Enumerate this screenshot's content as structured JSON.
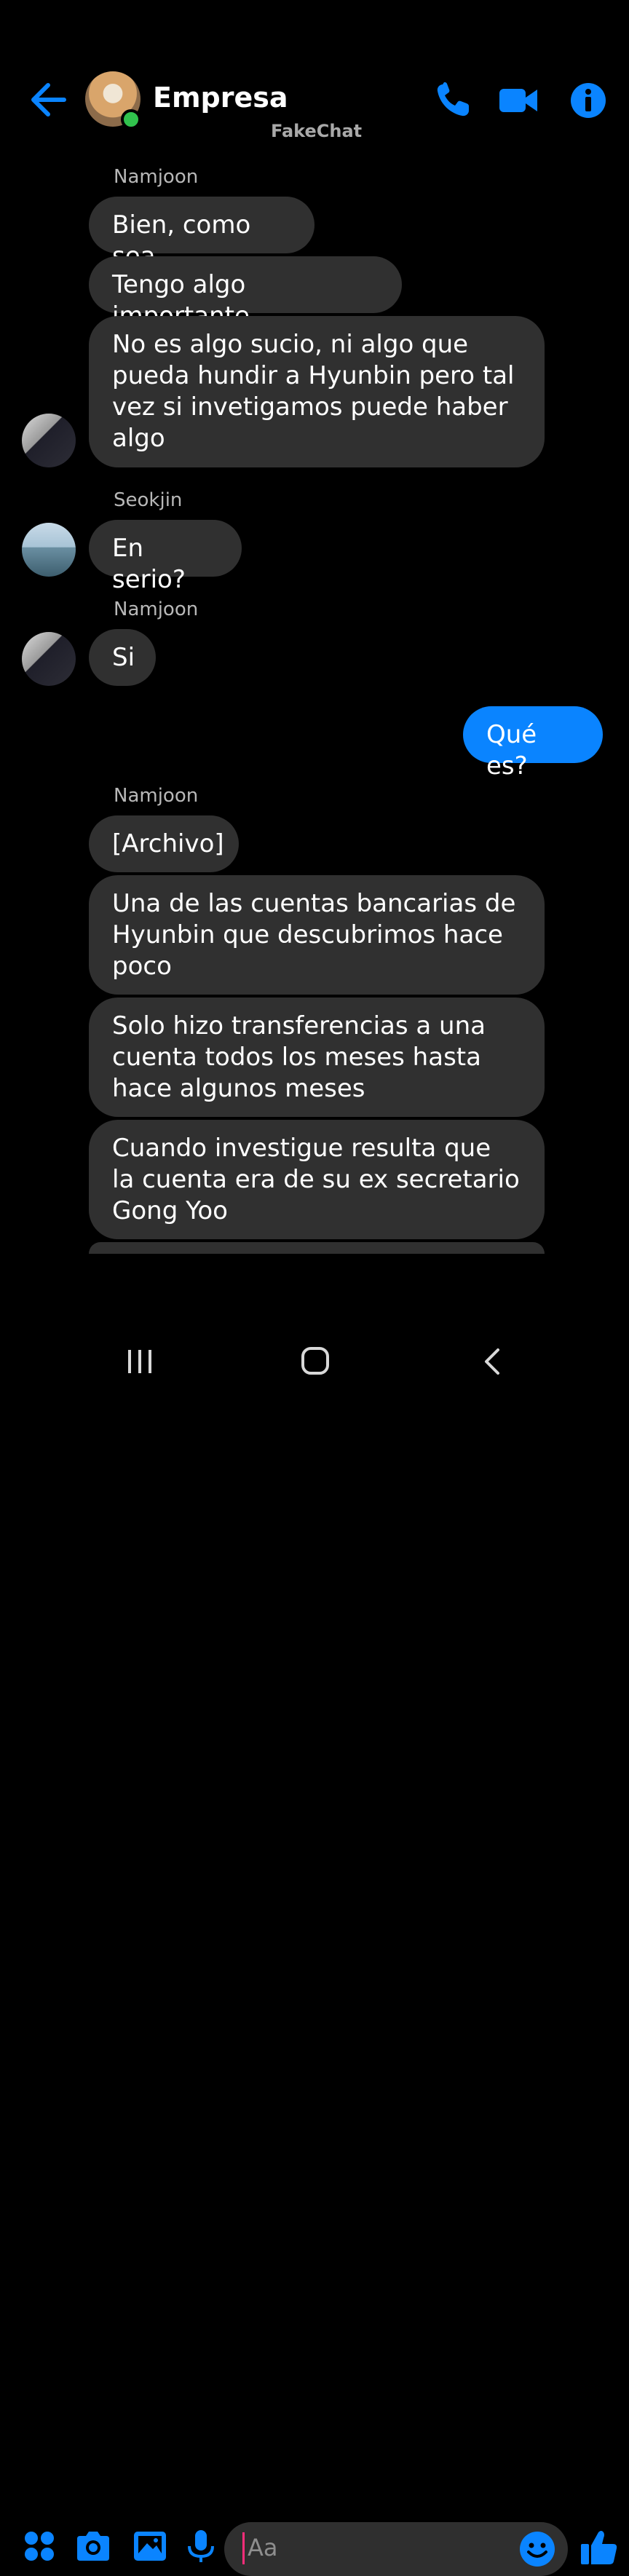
{
  "header": {
    "title": "Empresa",
    "watermark": "FakeChat"
  },
  "messages": [
    {
      "sender": "Namjoon"
    },
    {
      "text": "Bien, como sea"
    },
    {
      "text": "Tengo algo importante"
    },
    {
      "text": "No es algo sucio, ni algo que\npueda hundir a Hyunbin pero tal\nvez si invetigamos puede haber\nalgo"
    },
    {
      "sender": "Seokjin"
    },
    {
      "text": "En serio?"
    },
    {
      "sender": "Namjoon"
    },
    {
      "text": "Si"
    },
    {
      "text": "Qué es?"
    },
    {
      "sender": "Namjoon"
    },
    {
      "text": "[Archivo]"
    },
    {
      "text": "Una de las cuentas bancarias de\nHyunbin que descubrimos hace\npoco"
    },
    {
      "text": "Solo hizo transferencias a una\ncuenta todos los meses hasta\nhace algunos meses"
    },
    {
      "text": "Cuando investigue resulta que\nla cuenta era de su ex secretario\nGong Yoo"
    }
  ],
  "composer": {
    "placeholder": "Aa"
  },
  "colors": {
    "accent": "#0a84ff",
    "incoming_bubble": "#303030",
    "background": "#000000",
    "online": "#31c24d"
  },
  "icons": {
    "header": [
      "back-arrow-icon",
      "phone-icon",
      "video-camera-icon",
      "info-icon"
    ],
    "composer": [
      "apps-grid-icon",
      "camera-icon",
      "image-icon",
      "microphone-icon",
      "emoji-icon",
      "thumbs-up-icon"
    ],
    "navigation": [
      "recent-apps-icon",
      "home-icon",
      "back-icon"
    ]
  }
}
